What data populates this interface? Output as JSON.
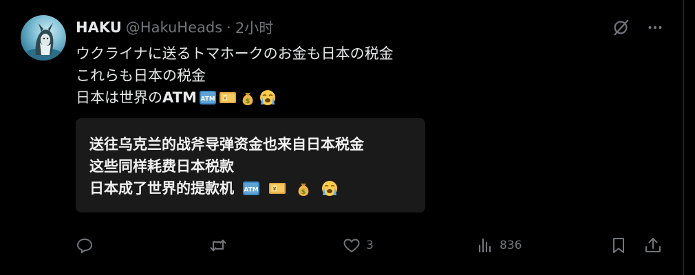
{
  "post": {
    "display_name": "HAKU",
    "handle": "@HakuHeads",
    "separator": "·",
    "time_ago": "2小时",
    "body_lines": [
      "ウクライナに送るトマホークのお金も日本の税金",
      "これらも日本の税金",
      "日本は世界の"
    ],
    "body_line3_bold": "ATM",
    "emojis": [
      "atm-emoji",
      "yen-banknote-emoji",
      "money-bag-emoji",
      "loudly-crying-face-emoji"
    ]
  },
  "translation": {
    "lines": [
      "送往乌克兰的战斧导弹资金也来自日本税金",
      "这些同样耗费日本税款",
      "日本成了世界的提款机"
    ]
  },
  "actions": {
    "reply_count": "",
    "repost_count": "",
    "like_count": "3",
    "view_count": "836"
  },
  "icons": [
    "grok-icon",
    "more-icon",
    "reply-icon",
    "repost-icon",
    "like-icon",
    "views-icon",
    "bookmark-icon",
    "share-icon"
  ],
  "colors": {
    "background": "#000000",
    "text": "#e7e9ea",
    "muted": "#71767b",
    "translation_box": "#1a1a1a"
  }
}
